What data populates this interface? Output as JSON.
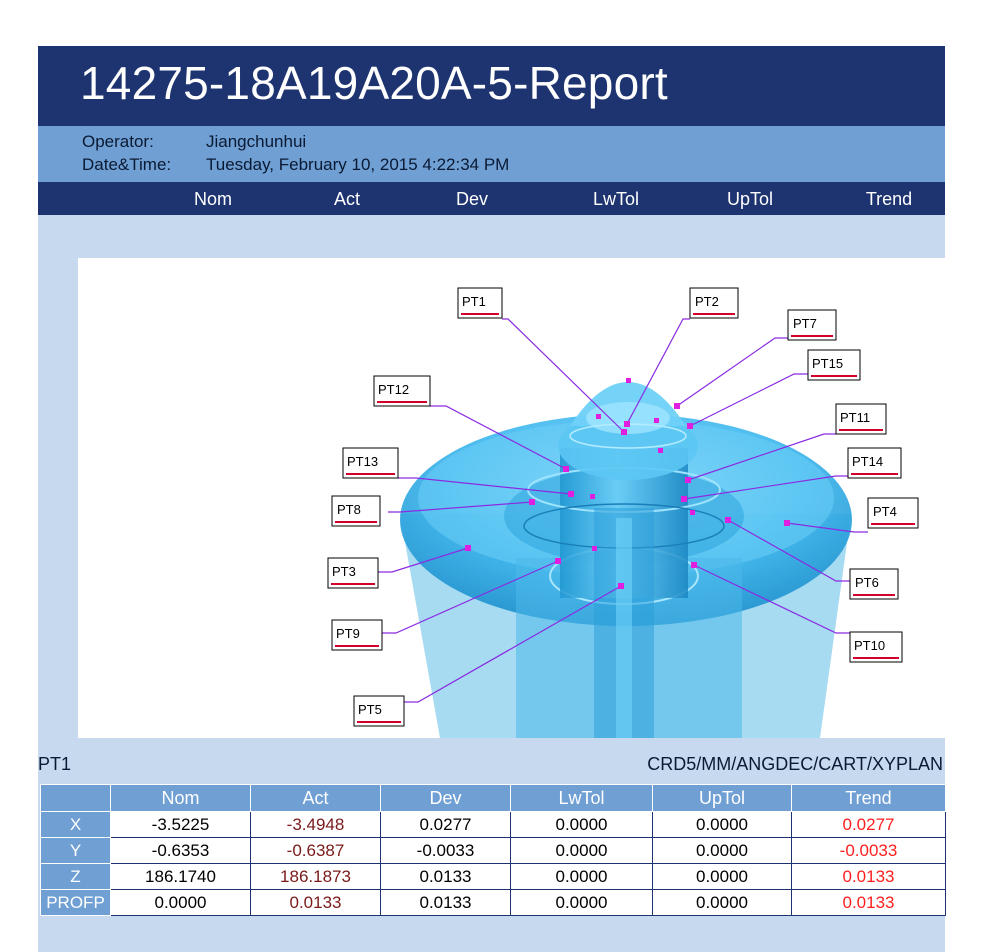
{
  "report": {
    "title": "14275-18A19A20A-5-Report",
    "operator_label": "Operator:",
    "operator": "Jiangchunhui",
    "datetime_label": "Date&Time:",
    "datetime": "Tuesday, February 10, 2015 4:22:34 PM"
  },
  "columns": [
    "Nom",
    "Act",
    "Dev",
    "LwTol",
    "UpTol",
    "Trend"
  ],
  "points": [
    "PT1",
    "PT2",
    "PT7",
    "PT15",
    "PT12",
    "PT11",
    "PT13",
    "PT14",
    "PT8",
    "PT4",
    "PT3",
    "PT6",
    "PT9",
    "PT10",
    "PT5"
  ],
  "feature": {
    "name": "PT1",
    "coord_system": "CRD5/MM/ANGDEC/CART/XYPLAN",
    "rows": [
      {
        "axis": "X",
        "nom": "-3.5225",
        "act": "-3.4948",
        "dev": "0.0277",
        "lwtol": "0.0000",
        "uptol": "0.0000",
        "trend": "0.0277"
      },
      {
        "axis": "Y",
        "nom": "-0.6353",
        "act": "-0.6387",
        "dev": "-0.0033",
        "lwtol": "0.0000",
        "uptol": "0.0000",
        "trend": "-0.0033"
      },
      {
        "axis": "Z",
        "nom": "186.1740",
        "act": "186.1873",
        "dev": "0.0133",
        "lwtol": "0.0000",
        "uptol": "0.0000",
        "trend": "0.0133"
      },
      {
        "axis": "PROFP",
        "nom": "0.0000",
        "act": "0.0133",
        "dev": "0.0133",
        "lwtol": "0.0000",
        "uptol": "0.0000",
        "trend": "0.0133"
      }
    ]
  },
  "colors": {
    "header_navy": "#1e3470",
    "info_blue": "#6f9fd3",
    "background": "#c7d9ee",
    "trend_red": "#ff1f1f",
    "part_cyan": "#3ab6ee",
    "marker_magenta": "#e01ee0"
  }
}
